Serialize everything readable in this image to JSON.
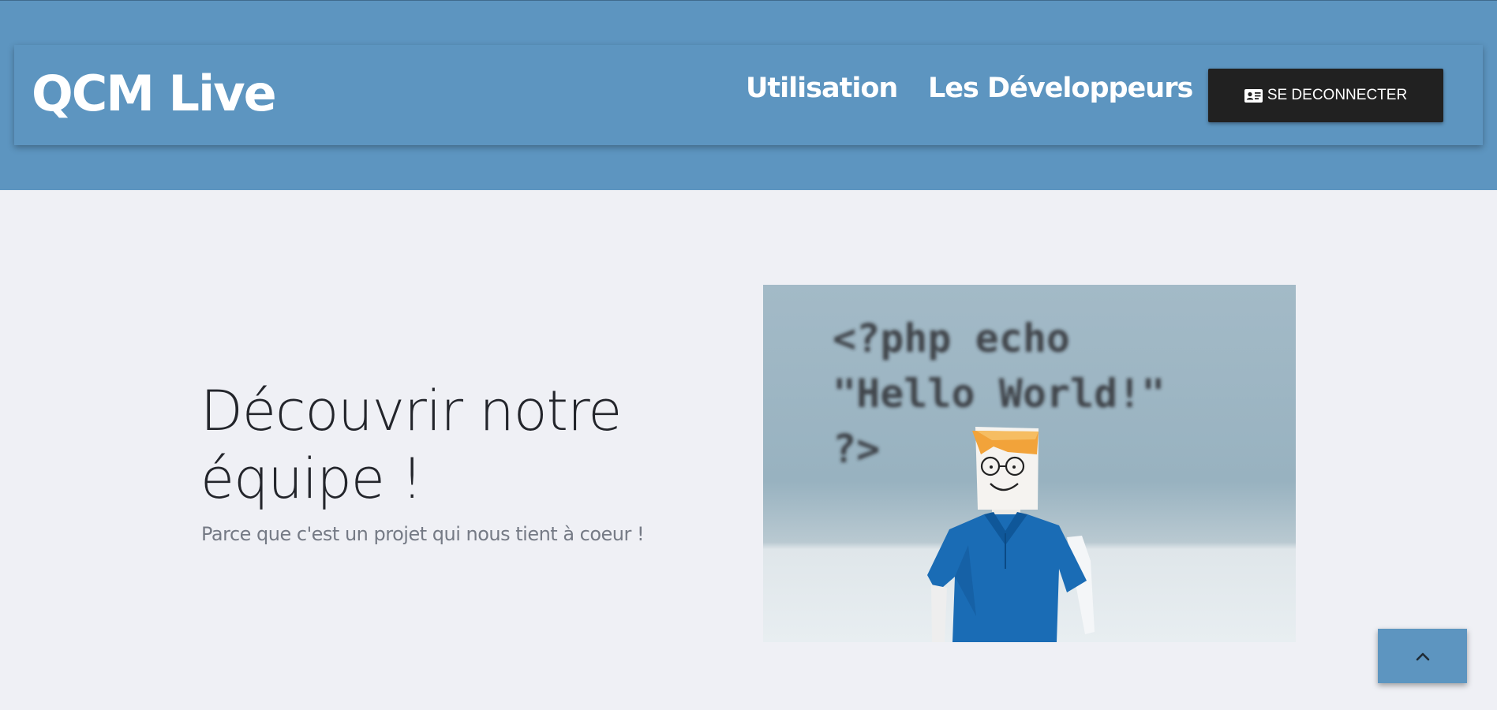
{
  "header": {
    "brand": "QCM Live",
    "nav": [
      {
        "label": "Utilisation"
      },
      {
        "label": "Les Développeurs"
      }
    ],
    "logout": {
      "label": "SE DECONNECTER",
      "icon": "id-card-icon"
    }
  },
  "hero": {
    "title": "Découvrir notre équipe !",
    "subtitle": "Parce que c'est un projet qui nous tient à coeur !",
    "image": {
      "code_lines": [
        "<?php echo",
        "\"Hello World!\"",
        "?>"
      ]
    }
  },
  "scroll_top": {
    "icon": "chevron-up-icon"
  },
  "colors": {
    "header_bg": "#5d95c0",
    "page_bg": "#eff0f5",
    "button_dark": "#212121",
    "title_text": "#23252b",
    "subtitle_text": "#757a85"
  }
}
